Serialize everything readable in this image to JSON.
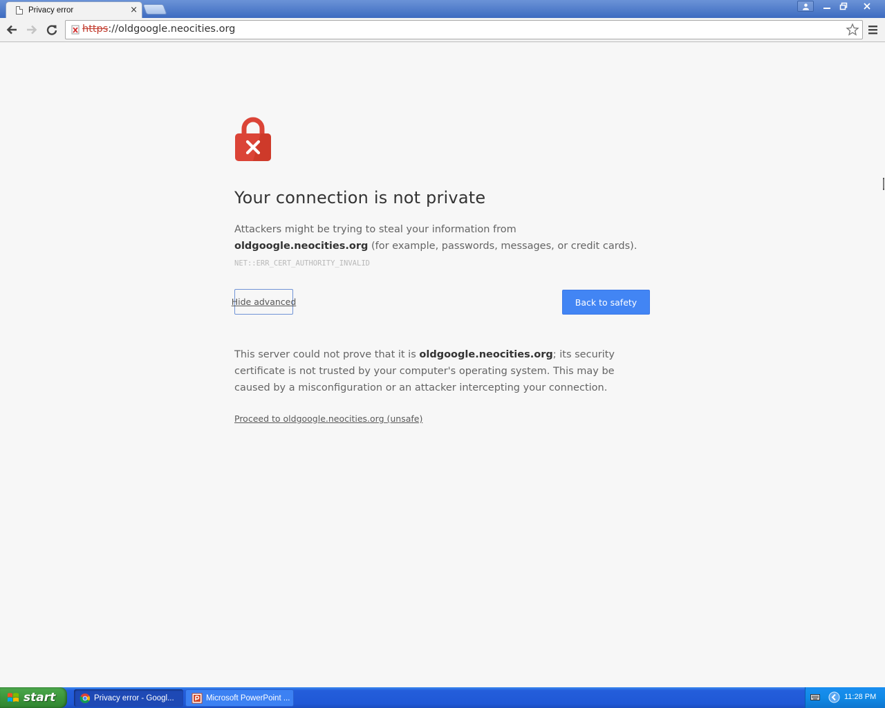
{
  "browser": {
    "tab": {
      "title": "Privacy error",
      "close_glyph": "×"
    },
    "window_controls": {
      "user_icon": "user-icon",
      "minimize": "minimize-icon",
      "restore": "restore-icon",
      "close": "close-icon"
    },
    "omnibox": {
      "scheme": "https",
      "rest": "://oldgoogle.neocities.org",
      "security_icon": "certificate-error-icon"
    },
    "toolbar_icons": [
      "back-arrow-icon",
      "forward-arrow-icon",
      "reload-icon",
      "star-icon",
      "menu-icon"
    ]
  },
  "page": {
    "heading": "Your connection is not private",
    "summary": {
      "prefix": "Attackers might be trying to steal your information from ",
      "host": "oldgoogle.neocities.org",
      "suffix": " (for example, passwords, messages, or credit cards). ",
      "error_code": "NET::ERR_CERT_AUTHORITY_INVALID"
    },
    "hide_advanced_label": "Hide advanced",
    "back_to_safety_label": "Back to safety",
    "details": {
      "prefix": "This server could not prove that it is ",
      "host": "oldgoogle.neocities.org",
      "suffix": "; its security certificate is not trusted by your computer's operating system. This may be caused by a misconfiguration or an attacker intercepting your connection."
    },
    "proceed_link": "Proceed to oldgoogle.neocities.org (unsafe)",
    "colors": {
      "lock_red": "#db4437",
      "button_blue": "#4285f4"
    }
  },
  "taskbar": {
    "start_label": "start",
    "items": [
      {
        "label": "Privacy error - Googl...",
        "icon": "chrome-icon",
        "active": true
      },
      {
        "label": "Microsoft PowerPoint ...",
        "icon": "powerpoint-icon",
        "active": false
      }
    ],
    "clock": "11:28 PM"
  }
}
